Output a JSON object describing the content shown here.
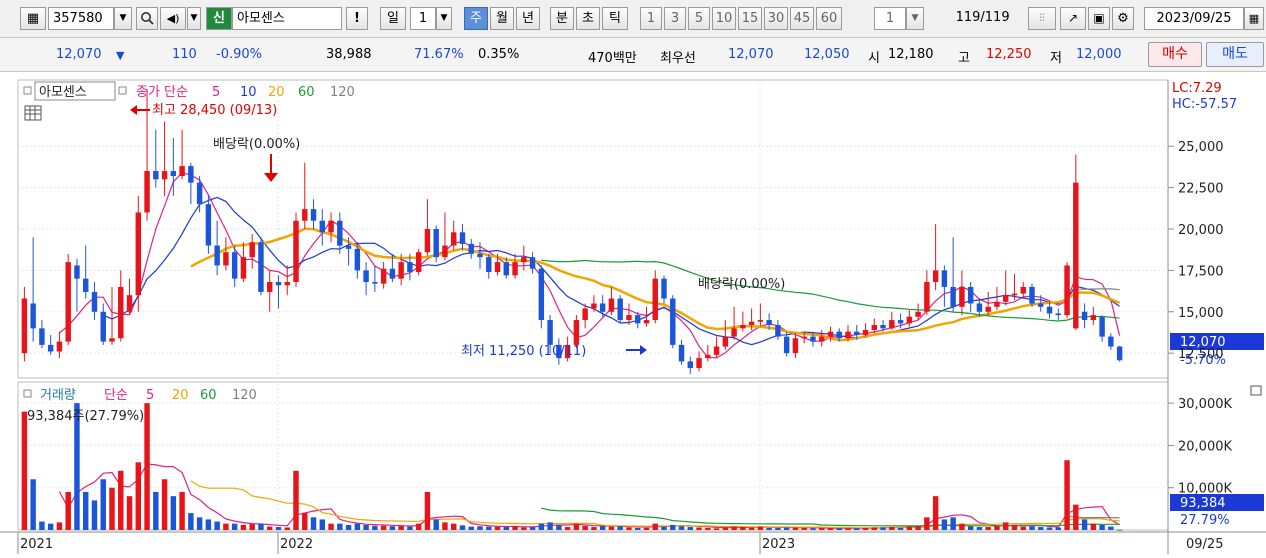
{
  "toolbar": {
    "stock_code": "357580",
    "credit_tag": "신",
    "stock_name": "아모센스",
    "excl": "!",
    "period_day": "일",
    "period_num": "1",
    "period_week": "주",
    "period_month": "월",
    "period_year": "년",
    "period_minute": "분",
    "period_second": "초",
    "period_tick": "틱",
    "quick_nums": [
      "1",
      "3",
      "5",
      "10",
      "15",
      "30",
      "45",
      "60"
    ],
    "count_value": "1",
    "page_count": "119",
    "page_total": "/119",
    "date": "2023/09/25"
  },
  "quote": {
    "price": "12,070",
    "change": "110",
    "change_rate": "-0.90%",
    "volume": "38,988",
    "ratio1": "71.67%",
    "ratio2": "0.35%",
    "amount": "470백만",
    "best_label": "최우선",
    "best_ask": "12,070",
    "best_bid": "12,050",
    "open_label": "시",
    "open": "12,180",
    "high_label": "고",
    "high": "12,250",
    "low_label": "저",
    "low": "12,000",
    "buy_label": "매수",
    "sell_label": "매도"
  },
  "price_panel": {
    "name": "아모센스",
    "ma_title": "종가 단순",
    "ma_periods": [
      "5",
      "10",
      "20",
      "60",
      "120"
    ],
    "ma_colors": [
      "#e0208a",
      "#1c39d6",
      "#f2a500",
      "#1a9a3a",
      "#808080"
    ],
    "lc": "LC:7.29",
    "hc": "HC:-57.57",
    "high_annot": "최고 28,450 (09/13)",
    "low_annot": "최저 11,250 (10/11)",
    "div1": "배당락(0.00%)",
    "div2": "배당락(0.00%)",
    "current_price": "12,070",
    "current_pct": "-5.70%",
    "y_ticks": [
      "25,000",
      "22,500",
      "20,000",
      "17,500",
      "15,000",
      "12,500"
    ]
  },
  "volume_panel": {
    "title": "거래량",
    "ma_title": "단순",
    "ma_periods": [
      "5",
      "20",
      "60",
      "120"
    ],
    "label": "93,384주(27.79%)",
    "current_volume": "93,384",
    "current_pct": "27.79%",
    "y_ticks": [
      "30,000K",
      "20,000K",
      "10,000K"
    ]
  },
  "x_axis": {
    "labels": [
      "2021",
      "2022",
      "2023"
    ],
    "date_label": "09/25"
  },
  "chart_data": {
    "type": "candlestick",
    "period": "weekly",
    "ylim_price": [
      11000,
      29000
    ],
    "ylim_volume_k": [
      0,
      35000
    ],
    "candles_approx": [
      {
        "o": 12500,
        "c": 15800,
        "h": 16500,
        "l": 12000,
        "v": 28000
      },
      {
        "o": 15500,
        "c": 14000,
        "h": 19500,
        "l": 13200,
        "v": 12000
      },
      {
        "o": 14000,
        "c": 13000,
        "h": 14500,
        "l": 12800,
        "v": 2000
      },
      {
        "o": 13000,
        "c": 12600,
        "h": 13600,
        "l": 12400,
        "v": 1500
      },
      {
        "o": 12600,
        "c": 13200,
        "h": 13800,
        "l": 12200,
        "v": 1800
      },
      {
        "o": 13200,
        "c": 18000,
        "h": 18500,
        "l": 13000,
        "v": 9000
      },
      {
        "o": 17800,
        "c": 17000,
        "h": 18200,
        "l": 15000,
        "v": 30000
      },
      {
        "o": 17000,
        "c": 16200,
        "h": 19000,
        "l": 15800,
        "v": 9000
      },
      {
        "o": 16200,
        "c": 15000,
        "h": 16800,
        "l": 14500,
        "v": 7000
      },
      {
        "o": 15000,
        "c": 13200,
        "h": 15500,
        "l": 13000,
        "v": 12000
      },
      {
        "o": 13200,
        "c": 13400,
        "h": 16500,
        "l": 13000,
        "v": 10000
      },
      {
        "o": 13400,
        "c": 16500,
        "h": 17500,
        "l": 13200,
        "v": 14000
      },
      {
        "o": 15000,
        "c": 16000,
        "h": 17000,
        "l": 14800,
        "v": 8000
      },
      {
        "o": 16000,
        "c": 21000,
        "h": 22000,
        "l": 15000,
        "v": 16000
      },
      {
        "o": 21000,
        "c": 23500,
        "h": 28450,
        "l": 20500,
        "v": 30000
      },
      {
        "o": 23500,
        "c": 23000,
        "h": 26000,
        "l": 22500,
        "v": 9000
      },
      {
        "o": 23000,
        "c": 23500,
        "h": 26500,
        "l": 22000,
        "v": 12000
      },
      {
        "o": 23500,
        "c": 23200,
        "h": 25500,
        "l": 22000,
        "v": 8000
      },
      {
        "o": 23200,
        "c": 23800,
        "h": 26000,
        "l": 23000,
        "v": 9000
      },
      {
        "o": 23800,
        "c": 22800,
        "h": 24000,
        "l": 21500,
        "v": 4000
      },
      {
        "o": 22800,
        "c": 21500,
        "h": 23200,
        "l": 21000,
        "v": 3000
      },
      {
        "o": 21500,
        "c": 19000,
        "h": 22000,
        "l": 18500,
        "v": 2500
      },
      {
        "o": 19000,
        "c": 17800,
        "h": 20500,
        "l": 17200,
        "v": 2000
      },
      {
        "o": 17800,
        "c": 18600,
        "h": 19500,
        "l": 17500,
        "v": 1500
      },
      {
        "o": 18600,
        "c": 17000,
        "h": 19000,
        "l": 16500,
        "v": 1500
      },
      {
        "o": 17000,
        "c": 18300,
        "h": 19200,
        "l": 16800,
        "v": 1200
      },
      {
        "o": 18300,
        "c": 19200,
        "h": 19700,
        "l": 17600,
        "v": 1400
      },
      {
        "o": 19200,
        "c": 16200,
        "h": 19500,
        "l": 16000,
        "v": 1500
      },
      {
        "o": 16200,
        "c": 16800,
        "h": 17500,
        "l": 15000,
        "v": 800
      },
      {
        "o": 16800,
        "c": 16600,
        "h": 17200,
        "l": 15200,
        "v": 700
      },
      {
        "o": 16600,
        "c": 16800,
        "h": 17800,
        "l": 16000,
        "v": 600
      },
      {
        "o": 16800,
        "c": 20500,
        "h": 21000,
        "l": 16500,
        "v": 14000
      },
      {
        "o": 20500,
        "c": 21200,
        "h": 24000,
        "l": 20000,
        "v": 4000
      },
      {
        "o": 21200,
        "c": 20500,
        "h": 21800,
        "l": 20000,
        "v": 3000
      },
      {
        "o": 20500,
        "c": 19800,
        "h": 21200,
        "l": 19000,
        "v": 2500
      },
      {
        "o": 19800,
        "c": 20500,
        "h": 21000,
        "l": 19200,
        "v": 1500
      },
      {
        "o": 20500,
        "c": 19000,
        "h": 21000,
        "l": 18500,
        "v": 1500
      },
      {
        "o": 19000,
        "c": 18800,
        "h": 19500,
        "l": 17800,
        "v": 1200
      },
      {
        "o": 18800,
        "c": 17500,
        "h": 19200,
        "l": 17000,
        "v": 1500
      },
      {
        "o": 17500,
        "c": 16800,
        "h": 18000,
        "l": 16000,
        "v": 1200
      },
      {
        "o": 16800,
        "c": 16700,
        "h": 17800,
        "l": 16200,
        "v": 1000
      },
      {
        "o": 16700,
        "c": 17600,
        "h": 18000,
        "l": 16400,
        "v": 1000
      },
      {
        "o": 17600,
        "c": 17000,
        "h": 18500,
        "l": 16800,
        "v": 900
      },
      {
        "o": 17000,
        "c": 18000,
        "h": 18500,
        "l": 16600,
        "v": 1000
      },
      {
        "o": 18000,
        "c": 17400,
        "h": 18500,
        "l": 16900,
        "v": 800
      },
      {
        "o": 17400,
        "c": 18600,
        "h": 18800,
        "l": 17200,
        "v": 1500
      },
      {
        "o": 18600,
        "c": 20000,
        "h": 21800,
        "l": 18400,
        "v": 9000
      },
      {
        "o": 20000,
        "c": 18300,
        "h": 20200,
        "l": 18000,
        "v": 2500
      },
      {
        "o": 18300,
        "c": 19000,
        "h": 21000,
        "l": 18100,
        "v": 1800
      },
      {
        "o": 19000,
        "c": 19800,
        "h": 20500,
        "l": 18700,
        "v": 1500
      },
      {
        "o": 19800,
        "c": 19100,
        "h": 20300,
        "l": 18700,
        "v": 1100
      },
      {
        "o": 19100,
        "c": 18500,
        "h": 19400,
        "l": 18200,
        "v": 800
      },
      {
        "o": 18500,
        "c": 18300,
        "h": 19200,
        "l": 17600,
        "v": 900
      },
      {
        "o": 18300,
        "c": 17400,
        "h": 18500,
        "l": 17000,
        "v": 800
      },
      {
        "o": 17400,
        "c": 18000,
        "h": 18500,
        "l": 17200,
        "v": 800
      },
      {
        "o": 18000,
        "c": 17200,
        "h": 18300,
        "l": 17000,
        "v": 700
      },
      {
        "o": 17200,
        "c": 18000,
        "h": 18500,
        "l": 17000,
        "v": 900
      },
      {
        "o": 18000,
        "c": 18300,
        "h": 19000,
        "l": 17500,
        "v": 600
      },
      {
        "o": 18300,
        "c": 17600,
        "h": 18600,
        "l": 17300,
        "v": 700
      },
      {
        "o": 17600,
        "c": 14500,
        "h": 17800,
        "l": 14000,
        "v": 1500
      },
      {
        "o": 14500,
        "c": 13000,
        "h": 14800,
        "l": 12500,
        "v": 1800
      },
      {
        "o": 13000,
        "c": 12200,
        "h": 13400,
        "l": 11800,
        "v": 1200
      },
      {
        "o": 12200,
        "c": 13000,
        "h": 13500,
        "l": 12000,
        "v": 700
      },
      {
        "o": 13000,
        "c": 14500,
        "h": 14800,
        "l": 12800,
        "v": 1500
      },
      {
        "o": 14500,
        "c": 15200,
        "h": 15500,
        "l": 14000,
        "v": 1000
      },
      {
        "o": 15200,
        "c": 15500,
        "h": 16000,
        "l": 15000,
        "v": 700
      },
      {
        "o": 15500,
        "c": 15000,
        "h": 16000,
        "l": 14700,
        "v": 1000
      },
      {
        "o": 15000,
        "c": 15800,
        "h": 16500,
        "l": 14800,
        "v": 800
      },
      {
        "o": 15800,
        "c": 14500,
        "h": 16000,
        "l": 14300,
        "v": 900
      },
      {
        "o": 14500,
        "c": 14800,
        "h": 15500,
        "l": 14200,
        "v": 600
      },
      {
        "o": 14800,
        "c": 14300,
        "h": 15000,
        "l": 14000,
        "v": 500
      },
      {
        "o": 14300,
        "c": 14500,
        "h": 15300,
        "l": 14100,
        "v": 500
      },
      {
        "o": 14500,
        "c": 17000,
        "h": 17500,
        "l": 14300,
        "v": 1500
      },
      {
        "o": 17000,
        "c": 15800,
        "h": 17200,
        "l": 15500,
        "v": 800
      },
      {
        "o": 15800,
        "c": 13000,
        "h": 16000,
        "l": 12800,
        "v": 1200
      },
      {
        "o": 13000,
        "c": 12000,
        "h": 13300,
        "l": 11800,
        "v": 900
      },
      {
        "o": 12000,
        "c": 11600,
        "h": 12300,
        "l": 11250,
        "v": 700
      },
      {
        "o": 11600,
        "c": 12200,
        "h": 12600,
        "l": 11400,
        "v": 600
      },
      {
        "o": 12200,
        "c": 12400,
        "h": 13000,
        "l": 12000,
        "v": 500
      },
      {
        "o": 12400,
        "c": 12900,
        "h": 13500,
        "l": 12200,
        "v": 400
      },
      {
        "o": 12900,
        "c": 13500,
        "h": 14500,
        "l": 12700,
        "v": 600
      },
      {
        "o": 13500,
        "c": 14000,
        "h": 15300,
        "l": 13300,
        "v": 800
      },
      {
        "o": 14000,
        "c": 14200,
        "h": 15000,
        "l": 13800,
        "v": 700
      },
      {
        "o": 14200,
        "c": 14400,
        "h": 15200,
        "l": 13900,
        "v": 600
      },
      {
        "o": 14400,
        "c": 14500,
        "h": 15500,
        "l": 14100,
        "v": 800
      },
      {
        "o": 14500,
        "c": 14200,
        "h": 14900,
        "l": 13900,
        "v": 500
      },
      {
        "o": 14200,
        "c": 13500,
        "h": 14500,
        "l": 13300,
        "v": 500
      },
      {
        "o": 13500,
        "c": 12500,
        "h": 13800,
        "l": 12300,
        "v": 600
      },
      {
        "o": 12500,
        "c": 13400,
        "h": 13700,
        "l": 12200,
        "v": 600
      },
      {
        "o": 13400,
        "c": 13500,
        "h": 13800,
        "l": 13100,
        "v": 500
      },
      {
        "o": 13500,
        "c": 13200,
        "h": 13700,
        "l": 12900,
        "v": 400
      },
      {
        "o": 13200,
        "c": 13500,
        "h": 13900,
        "l": 12900,
        "v": 400
      },
      {
        "o": 13500,
        "c": 13800,
        "h": 14100,
        "l": 13200,
        "v": 400
      },
      {
        "o": 13800,
        "c": 13400,
        "h": 14000,
        "l": 13200,
        "v": 400
      },
      {
        "o": 13400,
        "c": 13800,
        "h": 14200,
        "l": 13200,
        "v": 400
      },
      {
        "o": 13800,
        "c": 13600,
        "h": 14200,
        "l": 13300,
        "v": 400
      },
      {
        "o": 13600,
        "c": 13900,
        "h": 14300,
        "l": 13500,
        "v": 500
      },
      {
        "o": 13900,
        "c": 14200,
        "h": 14600,
        "l": 13700,
        "v": 600
      },
      {
        "o": 14200,
        "c": 14000,
        "h": 14500,
        "l": 13800,
        "v": 600
      },
      {
        "o": 14000,
        "c": 14500,
        "h": 15000,
        "l": 13900,
        "v": 700
      },
      {
        "o": 14500,
        "c": 14300,
        "h": 14900,
        "l": 14000,
        "v": 500
      },
      {
        "o": 14300,
        "c": 14700,
        "h": 15100,
        "l": 14100,
        "v": 800
      },
      {
        "o": 14700,
        "c": 15000,
        "h": 15500,
        "l": 14500,
        "v": 900
      },
      {
        "o": 15000,
        "c": 16800,
        "h": 17500,
        "l": 14800,
        "v": 3000
      },
      {
        "o": 16800,
        "c": 17500,
        "h": 20300,
        "l": 16300,
        "v": 8000
      },
      {
        "o": 17500,
        "c": 16500,
        "h": 17800,
        "l": 15300,
        "v": 2500
      },
      {
        "o": 16500,
        "c": 15300,
        "h": 19500,
        "l": 15000,
        "v": 3000
      },
      {
        "o": 15300,
        "c": 16500,
        "h": 17500,
        "l": 14800,
        "v": 1500
      },
      {
        "o": 16500,
        "c": 15500,
        "h": 16800,
        "l": 15000,
        "v": 900
      },
      {
        "o": 15500,
        "c": 15000,
        "h": 15800,
        "l": 14700,
        "v": 700
      },
      {
        "o": 15000,
        "c": 15300,
        "h": 16200,
        "l": 14800,
        "v": 700
      },
      {
        "o": 15300,
        "c": 15600,
        "h": 16500,
        "l": 15100,
        "v": 1000
      },
      {
        "o": 15600,
        "c": 16000,
        "h": 17500,
        "l": 15400,
        "v": 1800
      },
      {
        "o": 16000,
        "c": 16100,
        "h": 17300,
        "l": 15700,
        "v": 1200
      },
      {
        "o": 16100,
        "c": 16500,
        "h": 16800,
        "l": 15900,
        "v": 800
      },
      {
        "o": 16500,
        "c": 15500,
        "h": 16700,
        "l": 15300,
        "v": 900
      },
      {
        "o": 15500,
        "c": 15300,
        "h": 16000,
        "l": 15000,
        "v": 700
      },
      {
        "o": 15300,
        "c": 14900,
        "h": 15600,
        "l": 14600,
        "v": 600
      },
      {
        "o": 14900,
        "c": 14800,
        "h": 15200,
        "l": 14500,
        "v": 600
      },
      {
        "o": 14800,
        "c": 17800,
        "h": 18000,
        "l": 14600,
        "v": 16500
      },
      {
        "o": 14000,
        "c": 22800,
        "h": 24500,
        "l": 13900,
        "v": 6000
      },
      {
        "o": 15000,
        "c": 14500,
        "h": 15500,
        "l": 14000,
        "v": 2500
      },
      {
        "o": 14500,
        "c": 14800,
        "h": 15300,
        "l": 14200,
        "v": 1500
      },
      {
        "o": 14700,
        "c": 13500,
        "h": 14800,
        "l": 13200,
        "v": 1200
      },
      {
        "o": 13500,
        "c": 12900,
        "h": 13700,
        "l": 12700,
        "v": 800
      },
      {
        "o": 12900,
        "c": 12070,
        "h": 12950,
        "l": 12000,
        "v": 93
      }
    ]
  }
}
